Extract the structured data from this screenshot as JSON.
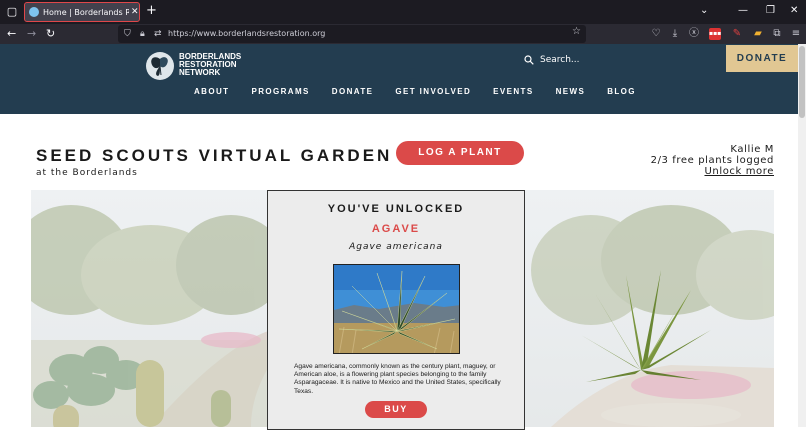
{
  "browser": {
    "tab_title": "Home | Borderlands Restoration",
    "url": "https://www.borderlandsrestoration.org"
  },
  "site": {
    "logo_lines": [
      "BORDERLANDS",
      "RESTORATION",
      "NETWORK"
    ],
    "search_placeholder": "Search...",
    "donate_label": "DONATE",
    "menu": [
      "ABOUT",
      "PROGRAMS",
      "DONATE",
      "GET INVOLVED",
      "EVENTS",
      "NEWS",
      "BLOG"
    ]
  },
  "page": {
    "title": "SEED SCOUTS VIRTUAL GARDEN",
    "subtitle": "at the Borderlands",
    "log_plant_label": "LOG A PLANT",
    "user_name": "Kallie M",
    "progress_text": "2/3 free plants logged",
    "unlock_more": "Unlock more"
  },
  "card": {
    "heading": "YOU'VE UNLOCKED",
    "plant_name": "AGAVE",
    "latin_name": "Agave americana",
    "description": "Agave americana, commonly known as the century plant, maguey, or American aloe, is a flowering plant species belonging to the  family Asparagaceae. It is native to Mexico and the United States,  specifically Texas.",
    "buy_label": "BUY"
  },
  "colors": {
    "header_bg": "#233d50",
    "accent_red": "#db4a49",
    "donate_gold": "#e1c793"
  }
}
